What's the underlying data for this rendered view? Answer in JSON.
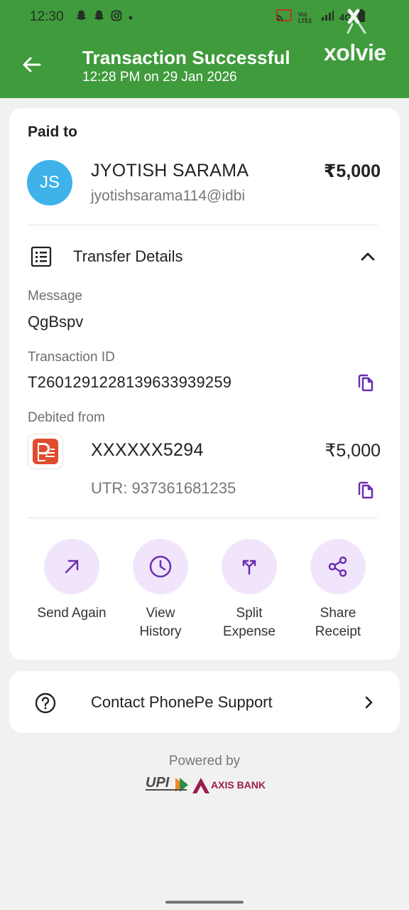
{
  "status_bar": {
    "time": "12:30",
    "left_icons": [
      "snapchat-icon",
      "snapchat-icon",
      "instagram-icon",
      "dot-icon"
    ],
    "volte": "Vo) LTE2",
    "network": "4G"
  },
  "header": {
    "title": "Transaction Successful",
    "subtitle": "12:28 PM on 29 Jan 2026",
    "watermark": "xolvie",
    "background": "#3f9b3c"
  },
  "payment": {
    "paid_to_label": "Paid to",
    "avatar_initials": "JS",
    "payee_name": "JYOTISH SARAMA",
    "payee_upi": "jyotishsarama114@idbi",
    "amount": "₹5,000"
  },
  "transfer": {
    "section_label": "Transfer Details",
    "message_label": "Message",
    "message_value": "QgBspv",
    "transaction_id_label": "Transaction ID",
    "transaction_id_value": "T2601291228139633939259",
    "debited_from_label": "Debited from",
    "account_number": "XXXXXX5294",
    "account_amount": "₹5,000",
    "utr": "UTR: 937361681235"
  },
  "actions": [
    {
      "line1": "Send Again",
      "line2": ""
    },
    {
      "line1": "View",
      "line2": "History"
    },
    {
      "line1": "Split",
      "line2": "Expense"
    },
    {
      "line1": "Share",
      "line2": "Receipt"
    }
  ],
  "support": {
    "label": "Contact PhonePe Support"
  },
  "footer": {
    "powered_by": "Powered by",
    "upi_logo_text": "UPI",
    "bank_logo_text": "AXIS BANK"
  },
  "colors": {
    "accent_purple": "#6a2fb2",
    "action_bg": "#f1e5fb",
    "avatar_bg": "#3fb2ea",
    "bank_red": "#df4d2e",
    "axis_maroon": "#9c1c4c"
  }
}
